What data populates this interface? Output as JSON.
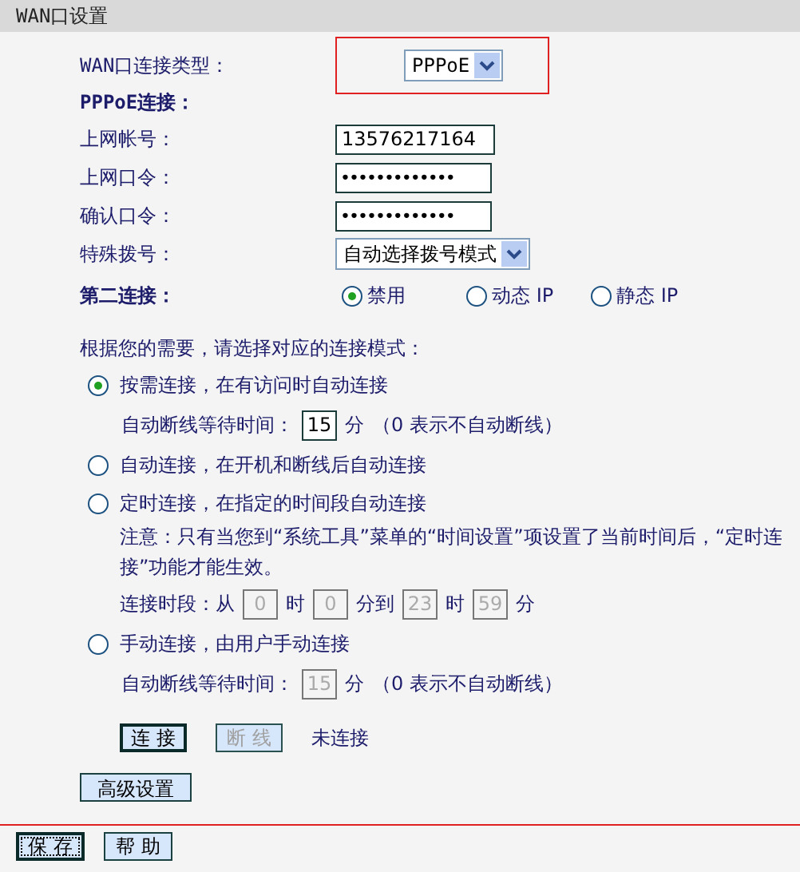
{
  "title": "WAN口设置",
  "wan_type": {
    "label": "WAN口连接类型：",
    "value": "PPPoE",
    "highlighted": true
  },
  "pppoe_heading": "PPPoE连接：",
  "fields": [
    {
      "label": "上网帐号：",
      "kind": "text",
      "value": "13576217164"
    },
    {
      "label": "上网口令：",
      "kind": "password",
      "value": "•••••••••••••"
    },
    {
      "label": "确认口令：",
      "kind": "password",
      "value": "•••••••••••••"
    },
    {
      "label": "特殊拨号：",
      "kind": "select",
      "value": "自动选择拨号模式"
    }
  ],
  "second_connection": {
    "label": "第二连接：",
    "options": [
      {
        "label": "禁用",
        "selected": true
      },
      {
        "label": "动态 IP",
        "selected": false
      },
      {
        "label": "静态 IP",
        "selected": false
      }
    ]
  },
  "mode_prompt": "根据您的需要，请选择对应的连接模式：",
  "modes": [
    {
      "label": "按需连接，在有访问时自动连接",
      "selected": true,
      "wait": {
        "label": "自动断线等待时间：",
        "value": "15",
        "unit": "分",
        "note": "（0 表示不自动断线）",
        "disabled": false
      }
    },
    {
      "label": "自动连接，在开机和断线后自动连接",
      "selected": false
    },
    {
      "label": "定时连接，在指定的时间段自动连接",
      "selected": false,
      "note": "注意：只有当您到“系统工具”菜单的“时间设置”项设置了当前时间后，“定时连接”功能才能生效。",
      "schedule": {
        "label": "连接时段：从",
        "disabled": true,
        "parts": [
          {
            "value": "0",
            "unit": "时"
          },
          {
            "value": "0",
            "unit": "分到"
          },
          {
            "value": "23",
            "unit": "时"
          },
          {
            "value": "59",
            "unit": "分"
          }
        ]
      }
    },
    {
      "label": "手动连接，由用户手动连接",
      "selected": false,
      "wait": {
        "label": "自动断线等待时间：",
        "value": "15",
        "unit": "分",
        "note": "（0 表示不自动断线）",
        "disabled": true
      }
    }
  ],
  "actions": [
    {
      "label": "连 接",
      "disabled": false
    },
    {
      "label": "断 线",
      "disabled": true
    }
  ],
  "connection_status": "未连接",
  "advanced_button": "高级设置",
  "footer_buttons": [
    {
      "label": "保 存",
      "focused": true
    },
    {
      "label": "帮 助",
      "focused": false
    }
  ]
}
